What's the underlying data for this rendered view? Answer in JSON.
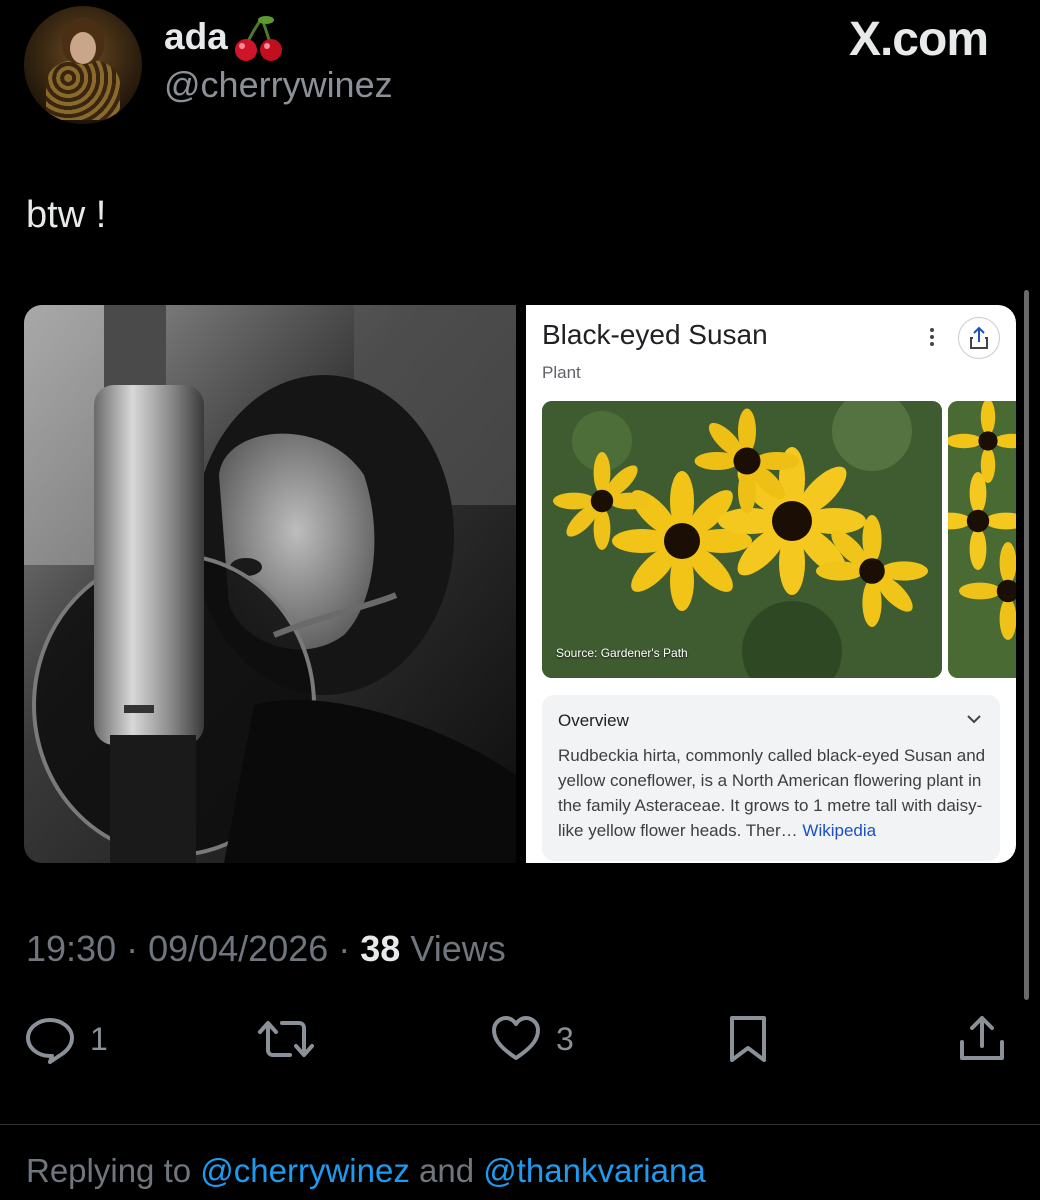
{
  "header": {
    "display_name": "ada",
    "handle": "@cherrywinez",
    "watermark": "X.com"
  },
  "tweet": {
    "text": "btw !"
  },
  "knowledge_card": {
    "title": "Black-eyed Susan",
    "subtitle": "Plant",
    "image_source": "Source: Gardener's Path",
    "overview_title": "Overview",
    "overview_text": "Rudbeckia hirta, commonly called black-eyed Susan and yellow coneflower, is a North American flowering plant in the family Asteraceae. It grows to 1 metre tall with daisy-like yellow flower heads. Ther… ",
    "overview_link": "Wikipedia"
  },
  "meta": {
    "time": "19:30",
    "sep1": " · ",
    "date": "09/04/2026",
    "sep2": " · ",
    "views_count": "38",
    "views_label": " Views"
  },
  "actions": {
    "reply_count": "1",
    "like_count": "3"
  },
  "reply": {
    "prefix": "Replying to ",
    "mention1": "@cherrywinez",
    "joiner": " and ",
    "mention2": "@thankvariana"
  },
  "colors": {
    "background": "#000000",
    "text_primary": "#e7e9ea",
    "text_secondary": "#6f767d",
    "accent_blue": "#1d9bf0",
    "link_blue": "#1a4fc7",
    "flower_yellow": "#f2c418"
  },
  "icons": [
    "cherry-icon",
    "kebab-menu-icon",
    "share-icon",
    "chevron-down-icon",
    "reply-icon",
    "repost-icon",
    "heart-icon",
    "bookmark-icon",
    "share-upload-icon"
  ]
}
